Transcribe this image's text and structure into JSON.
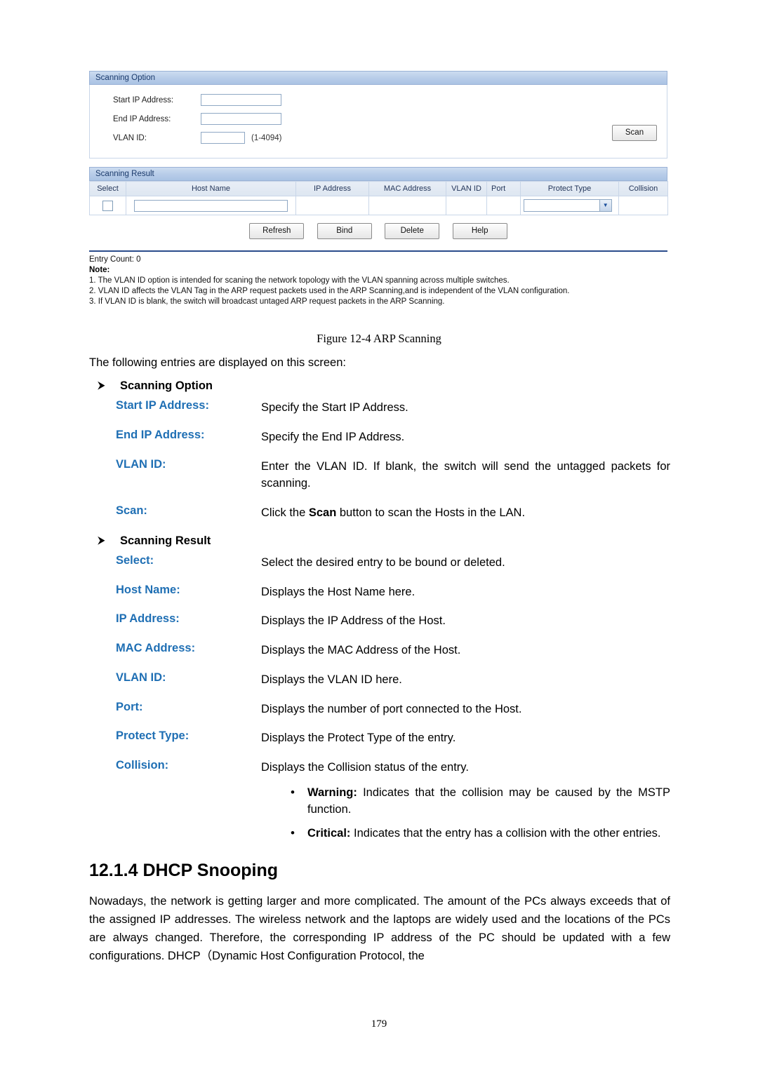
{
  "screenshot": {
    "scanning_option": {
      "title": "Scanning Option",
      "labels": {
        "start_ip": "Start IP Address:",
        "end_ip": "End IP Address:",
        "vlan_id": "VLAN ID:"
      },
      "vlan_hint": "(1-4094)",
      "scan_button": "Scan",
      "values": {
        "start_ip": "",
        "end_ip": "",
        "vlan_id": ""
      }
    },
    "scanning_result": {
      "title": "Scanning Result",
      "columns": [
        "Select",
        "Host Name",
        "IP Address",
        "MAC Address",
        "VLAN ID",
        "Port",
        "Protect Type",
        "Collision"
      ],
      "row": {
        "host_name_value": "",
        "ip_address": "",
        "mac_address": "",
        "vlan_id": "",
        "port": "",
        "protect_type_selected": "",
        "collision": ""
      }
    },
    "buttons": {
      "refresh": "Refresh",
      "bind": "Bind",
      "delete": "Delete",
      "help": "Help"
    },
    "entry_count": "Entry Count: 0",
    "note_title": "Note:",
    "notes": [
      "1. The VLAN ID option is intended for scaning the network topology with the VLAN spanning across multiple switches.",
      "2. VLAN ID affects the VLAN Tag in the ARP request packets used in the ARP Scanning,and is independent of the VLAN configuration.",
      "3. If VLAN ID is blank, the switch will broadcast untaged ARP request packets in the ARP Scanning."
    ]
  },
  "figure_caption": "Figure 12-4 ARP Scanning",
  "intro": "The following entries are displayed on this screen:",
  "groups": [
    {
      "marker": "⮞",
      "heading": "Scanning Option",
      "items": [
        {
          "term": "Start IP Address:",
          "desc": "Specify the Start IP Address."
        },
        {
          "term": "End IP Address:",
          "desc": "Specify the End IP Address."
        },
        {
          "term": "VLAN ID:",
          "desc": "Enter the VLAN ID. If blank, the switch will send the untagged packets for scanning."
        },
        {
          "term": "Scan:",
          "desc_pre": "Click the ",
          "desc_bold": "Scan",
          "desc_post": " button to scan the Hosts in the LAN."
        }
      ]
    },
    {
      "marker": "⮞",
      "heading": "Scanning Result",
      "items": [
        {
          "term": "Select:",
          "desc": "Select the desired entry to be bound or deleted."
        },
        {
          "term": "Host Name:",
          "desc": "Displays the Host Name here."
        },
        {
          "term": "IP Address:",
          "desc": "Displays the IP Address of the Host."
        },
        {
          "term": "MAC Address:",
          "desc": "Displays the MAC Address of the Host."
        },
        {
          "term": "VLAN ID:",
          "desc": "Displays the VLAN ID here."
        },
        {
          "term": "Port:",
          "desc": "Displays the number of port connected to the Host."
        },
        {
          "term": "Protect Type:",
          "desc": "Displays the Protect Type of the entry."
        },
        {
          "term": "Collision:",
          "desc": "Displays the Collision status of the entry."
        }
      ],
      "sub_bullets": [
        {
          "bold": "Warning:",
          "text": " Indicates that the collision may be caused by the MSTP function."
        },
        {
          "bold": "Critical:",
          "text": " Indicates that the entry has a collision with the other entries."
        }
      ]
    }
  ],
  "section": {
    "number_title": "12.1.4  DHCP Snooping",
    "paragraph": "Nowadays, the network is getting larger and more complicated. The amount of the PCs always exceeds that of the assigned IP addresses. The wireless network and the laptops are widely used and the locations of the PCs are always changed. Therefore, the corresponding IP address of the PC should be updated with a few configurations. DHCP（Dynamic Host Configuration Protocol, the"
  },
  "page_number": "179"
}
